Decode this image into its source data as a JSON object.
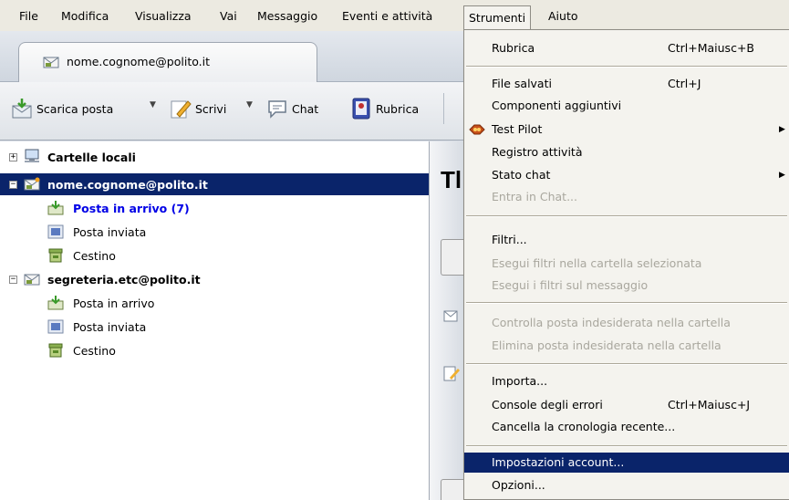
{
  "menubar": {
    "items": [
      {
        "label": "File",
        "x": 0
      },
      {
        "label": "Modifica"
      },
      {
        "label": "Visualizza"
      },
      {
        "label": "Vai"
      },
      {
        "label": "Messaggio"
      },
      {
        "label": "Eventi e attività"
      },
      {
        "label": "Strumenti"
      },
      {
        "label": "Aiuto"
      }
    ]
  },
  "tab": {
    "label": "nome.cognome@polito.it"
  },
  "toolbar": {
    "get_mail": "Scarica posta",
    "write": "Scrivi",
    "chat": "Chat",
    "address_book": "Rubrica"
  },
  "folders": {
    "local": "Cartelle locali",
    "account1": {
      "name": "nome.cognome@polito.it",
      "inbox": "Posta in arrivo (7)",
      "sent": "Posta inviata",
      "trash": "Cestino"
    },
    "account2": {
      "name": "segreteria.etc@polito.it",
      "inbox": "Posta in arrivo",
      "sent": "Posta inviata",
      "trash": "Cestino"
    }
  },
  "content": {
    "title_fragment": "Tl"
  },
  "strumenti_menu": {
    "rubrica": "Rubrica",
    "rubrica_sc": "Ctrl+Maiusc+B",
    "file_salvati": "File salvati",
    "file_salvati_sc": "Ctrl+J",
    "componenti": "Componenti aggiuntivi",
    "test_pilot": "Test Pilot",
    "registro": "Registro attività",
    "stato_chat": "Stato chat",
    "entra_chat": "Entra in Chat...",
    "filtri": "Filtri...",
    "esegui_cartella": "Esegui filtri nella cartella selezionata",
    "esegui_messaggio": "Esegui i filtri sul messaggio",
    "controlla_indesiderata": "Controlla posta indesiderata nella cartella",
    "elimina_indesiderata": "Elimina posta indesiderata nella cartella",
    "importa": "Importa...",
    "console": "Console degli errori",
    "console_sc": "Ctrl+Maiusc+J",
    "cancella": "Cancella la cronologia recente...",
    "impostazioni": "Impostazioni account...",
    "opzioni": "Opzioni..."
  },
  "colors": {
    "selection": "#0a246a",
    "menu_bg": "#f4f3ee",
    "unread": "#0000e6",
    "disabled": "#a9a79e"
  }
}
